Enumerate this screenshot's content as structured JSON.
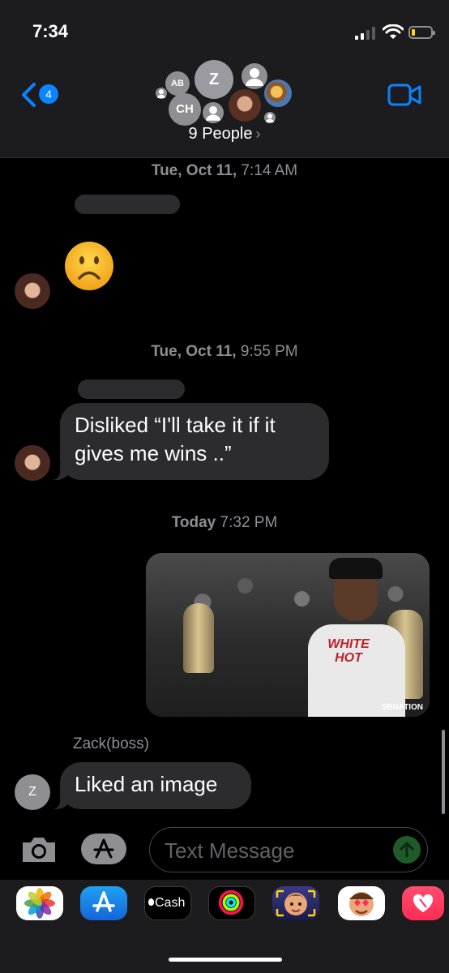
{
  "status_bar": {
    "time": "7:34"
  },
  "header": {
    "back_badge_count": "4",
    "group_label": "9 People",
    "avatars": [
      {
        "name": "AB",
        "kind": "initials"
      },
      {
        "name": "Z",
        "kind": "initials"
      },
      {
        "name": "CH",
        "kind": "initials"
      },
      {
        "name": "",
        "kind": "person-icon"
      },
      {
        "name": "",
        "kind": "photo"
      },
      {
        "name": "",
        "kind": "cartoon"
      }
    ]
  },
  "messages": {
    "timestamp_1": {
      "day": "Tue, Oct 11,",
      "time": "7:14 AM"
    },
    "emoji_1": "frowning-face",
    "timestamp_2": {
      "day": "Tue, Oct 11,",
      "time": "9:55 PM"
    },
    "bubble_1": "Disliked “I'll take it if it gives me wins ..”",
    "timestamp_3": {
      "day": "Today",
      "time": "7:32 PM"
    },
    "image_shirt_text": "WHITE HOT",
    "image_watermark": "SBNATION",
    "sender_name": "Zack(boss)",
    "sender_initial": "Z",
    "bubble_2": "Liked an image"
  },
  "input_bar": {
    "placeholder": "Text Message"
  },
  "app_drawer": {
    "apps": [
      "Photos",
      "App Store",
      "Cash",
      "Activity",
      "Memoji",
      "Memoji Stickers",
      "Digital Touch"
    ],
    "cash_label": "Cash"
  },
  "colors": {
    "accent": "#0a84ff",
    "bubble": "#2c2c2e",
    "secondary_text": "#8e8e93",
    "battery": "#ffd60a"
  }
}
